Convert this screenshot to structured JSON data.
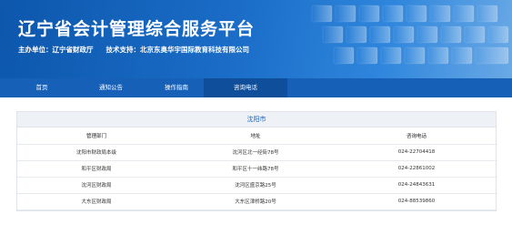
{
  "header": {
    "title": "辽宁省会计管理综合服务平台",
    "organizer_label": "主办单位：",
    "organizer": "辽宁省财政厅",
    "tech_label": "技术支持：",
    "tech": "北京东奥华宇国际教育科技有限公司"
  },
  "nav": {
    "items": [
      {
        "label": "首页"
      },
      {
        "label": "通知公告"
      },
      {
        "label": "操作指南"
      },
      {
        "label": "咨询电话"
      }
    ],
    "active_index": 3
  },
  "contacts": {
    "city": "沈阳市",
    "columns": [
      "管理部门",
      "地址",
      "咨询电话"
    ],
    "rows": [
      [
        "沈阳市财政局本级",
        "沈河区北一经街78号",
        "024-22704418"
      ],
      [
        "和平区财政局",
        "和平区十一纬路78号",
        "024-22861002"
      ],
      [
        "沈河区财政局",
        "沈河区盛京路25号",
        "024-24843631"
      ],
      [
        "大东区财政局",
        "大东区津桥路20号",
        "024-88539860"
      ]
    ]
  },
  "colors": {
    "banner": "#1a6cc6",
    "nav": "#1760b8",
    "nav_active": "#0f4e9a",
    "city_text": "#1b63b8"
  }
}
